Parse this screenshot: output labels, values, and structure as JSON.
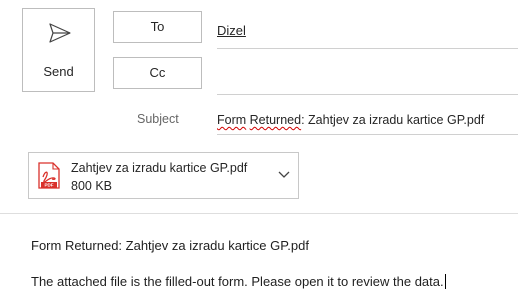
{
  "compose": {
    "send_label": "Send",
    "to_label": "To",
    "cc_label": "Cc",
    "to_value": "Dizel",
    "cc_value": "",
    "subject_label": "Subject",
    "subject_word1": "Form",
    "subject_word2": "Returned",
    "subject_rest": ": Zahtjev za izradu kartice GP.pdf"
  },
  "attachment": {
    "name": "Zahtjev za izradu kartice GP.pdf",
    "size": "800 KB",
    "icon": "pdf-icon"
  },
  "body": {
    "line1": "Form Returned: Zahtjev za izradu kartice GP.pdf",
    "line2": "The attached file is the filled-out form. Please open it to review the data."
  },
  "colors": {
    "pdf_red": "#d9312b",
    "border": "#bdbdbd",
    "spellcheck": "#d00000"
  }
}
